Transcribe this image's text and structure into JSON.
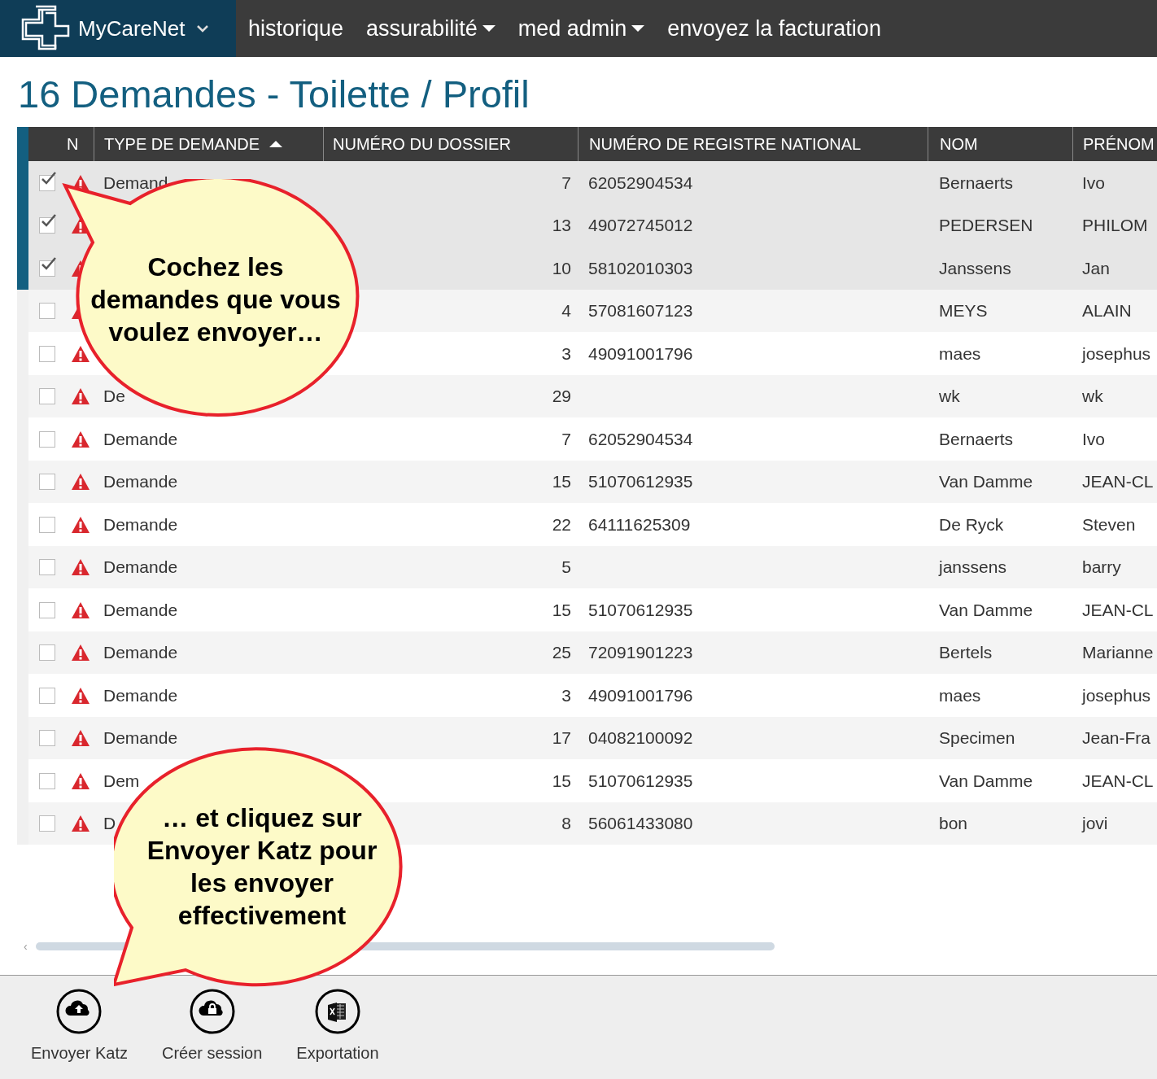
{
  "navbar": {
    "brand": {
      "label": "MyCareNet",
      "dropdown": true
    },
    "items": [
      {
        "label": "historique",
        "dropdown": false
      },
      {
        "label": "assurabilité",
        "dropdown": true
      },
      {
        "label": "med admin",
        "dropdown": true
      },
      {
        "label": "envoyez la facturation",
        "dropdown": false
      }
    ]
  },
  "title": "16 Demandes - Toilette / Profil",
  "table": {
    "columns": [
      {
        "label": "N",
        "kind": "no"
      },
      {
        "label": "TYPE DE DEMANDE",
        "kind": "type",
        "sorted_ascending": true
      },
      {
        "label": "NUMÉRO DU DOSSIER",
        "kind": "dossier"
      },
      {
        "label": "NUMÉRO DE REGISTRE NATIONAL",
        "kind": "nrn"
      },
      {
        "label": "NOM",
        "kind": "nom"
      },
      {
        "label": "PRÉNOM",
        "kind": "prenom"
      }
    ],
    "rows": [
      {
        "checked": true,
        "type": "Demand",
        "dossier": "7",
        "nrn": "62052904534",
        "nom": "Bernaerts",
        "prenom": "Ivo"
      },
      {
        "checked": true,
        "dossier": "13",
        "nrn": "49072745012",
        "nom": "PEDERSEN",
        "prenom": "PHILOM"
      },
      {
        "checked": true,
        "dossier": "10",
        "nrn": "58102010303",
        "nom": "Janssens",
        "prenom": "Jan"
      },
      {
        "checked": false,
        "dossier": "4",
        "nrn": "57081607123",
        "nom": "MEYS",
        "prenom": "ALAIN"
      },
      {
        "checked": false,
        "dossier": "3",
        "nrn": "49091001796",
        "nom": "maes",
        "prenom": "josephus"
      },
      {
        "checked": false,
        "type": "De",
        "dossier": "29",
        "nom": "wk",
        "prenom": "wk"
      },
      {
        "checked": false,
        "type": "Demande",
        "dossier": "7",
        "nrn": "62052904534",
        "nom": "Bernaerts",
        "prenom": "Ivo"
      },
      {
        "checked": false,
        "type": "Demande",
        "dossier": "15",
        "nrn": "51070612935",
        "nom": "Van Damme",
        "prenom": "JEAN-CL"
      },
      {
        "checked": false,
        "type": "Demande",
        "dossier": "22",
        "nrn": "64111625309",
        "nom": "De Ryck",
        "prenom": "Steven"
      },
      {
        "checked": false,
        "type": "Demande",
        "dossier": "5",
        "nom": "janssens",
        "prenom": "barry"
      },
      {
        "checked": false,
        "type": "Demande",
        "dossier": "15",
        "nrn": "51070612935",
        "nom": "Van Damme",
        "prenom": "JEAN-CL"
      },
      {
        "checked": false,
        "type": "Demande",
        "dossier": "25",
        "nrn": "72091901223",
        "nom": "Bertels",
        "prenom": "Marianne"
      },
      {
        "checked": false,
        "type": "Demande",
        "dossier": "3",
        "nrn": "49091001796",
        "nom": "maes",
        "prenom": "josephus"
      },
      {
        "checked": false,
        "type": "Demande",
        "dossier": "17",
        "nrn": "04082100092",
        "nom": "Specimen",
        "prenom": "Jean-Fra"
      },
      {
        "checked": false,
        "type": "Dem",
        "dossier": "15",
        "nrn": "51070612935",
        "nom": "Van Damme",
        "prenom": "JEAN-CL"
      },
      {
        "checked": false,
        "type": "D",
        "dossier": "8",
        "nrn": "56061433080",
        "nom": "bon",
        "prenom": "jovi"
      }
    ]
  },
  "scroll_left": "‹",
  "toolbar": [
    {
      "label": "Envoyer Katz",
      "kind": "upload"
    },
    {
      "label": "Créer session",
      "kind": "session"
    },
    {
      "label": "Exportation",
      "kind": "excel"
    }
  ],
  "callouts": [
    {
      "text": "Cochez les\ndemandes que vous\nvoulez envoyer…",
      "kind": "top"
    },
    {
      "text": "… et cliquez sur\nEnvoyer Katz pour\nles envoyer\neffectivement",
      "kind": "bottom"
    }
  ]
}
